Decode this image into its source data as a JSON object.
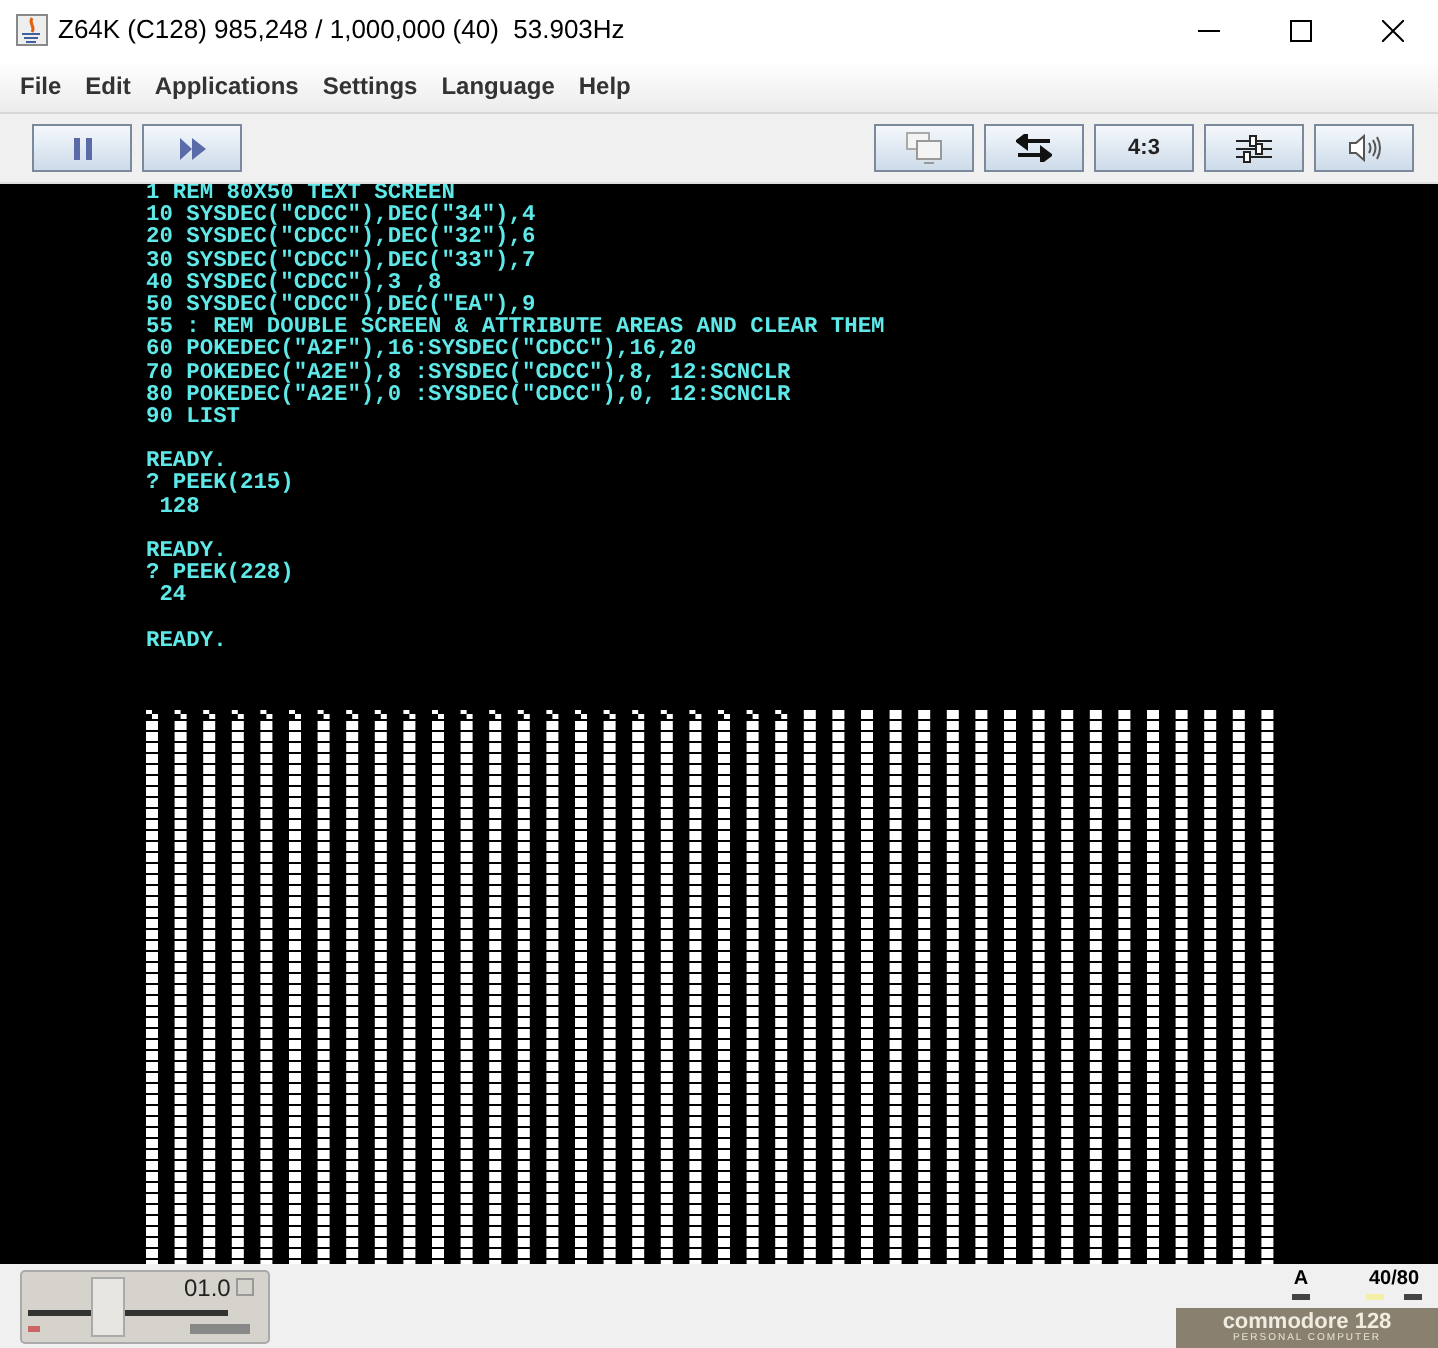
{
  "window": {
    "title": "Z64K (C128) 985,248 / 1,000,000 (40)  53.903Hz"
  },
  "menu": [
    "File",
    "Edit",
    "Applications",
    "Settings",
    "Language",
    "Help"
  ],
  "toolbar": {
    "left": [
      {
        "kind": "pause"
      },
      {
        "kind": "fast_forward"
      }
    ],
    "right": [
      {
        "kind": "monitor"
      },
      {
        "kind": "swap"
      },
      {
        "kind": "text",
        "label": "4:3"
      },
      {
        "kind": "sliders"
      },
      {
        "kind": "speaker"
      }
    ]
  },
  "screen": {
    "blocks": [
      [
        "1 REM 80X50 TEXT SCREEN",
        "10 SYSDEC(\"CDCC\"),DEC(\"34\"),4",
        "20 SYSDEC(\"CDCC\"),DEC(\"32\"),6",
        "30 SYSDEC(\"CDCC\"),DEC(\"33\"),7",
        "40 SYSDEC(\"CDCC\"),3 ,8",
        "50 SYSDEC(\"CDCC\"),DEC(\"EA\"),9",
        "55 : REM DOUBLE SCREEN & ATTRIBUTE AREAS AND CLEAR THEM",
        "60 POKEDEC(\"A2F\"),16:SYSDEC(\"CDCC\"),16,20",
        "70 POKEDEC(\"A2E\"),8 :SYSDEC(\"CDCC\"),8, 12:SCNCLR",
        "80 POKEDEC(\"A2E\"),0 :SYSDEC(\"CDCC\"),0, 12:SCNCLR",
        "90 LIST"
      ],
      [
        "READY.",
        "? PEEK(215)",
        " 128"
      ],
      [
        "READY.",
        "? PEEK(228)",
        " 24"
      ],
      [
        "READY."
      ]
    ]
  },
  "status": {
    "drive_label": "01.0",
    "indicators": [
      {
        "label": "A",
        "leds": [
          {
            "lit": false
          }
        ]
      },
      {
        "label": "40/80",
        "leds": [
          {
            "lit": true
          },
          {
            "lit": false
          }
        ]
      }
    ],
    "logo": {
      "brand": "commodore 128",
      "subtitle": "PERSONAL COMPUTER"
    }
  }
}
